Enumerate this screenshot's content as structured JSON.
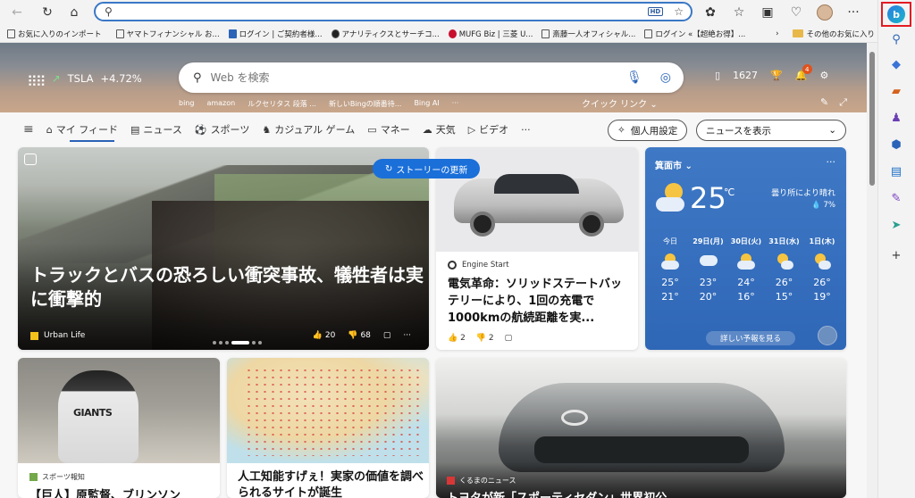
{
  "browser": {
    "address_value": "",
    "address_badge": "HD",
    "favorites": [
      {
        "label": "お気に入りのインポート",
        "icon": "import-icon"
      },
      {
        "label": "ヤマトフィナンシャル お...",
        "icon": "page-icon"
      },
      {
        "label": "ログイン | ご契約者様...",
        "icon": "blue-page-icon"
      },
      {
        "label": "アナリティクスとサーチコ...",
        "icon": "dark-circle-icon"
      },
      {
        "label": "MUFG Biz | 三菱 U...",
        "icon": "mufg-icon"
      },
      {
        "label": "斎藤一人オフィシャル...",
        "icon": "page-icon"
      },
      {
        "label": "ログイン «【超絶お得】...",
        "icon": "page-icon"
      }
    ],
    "other_favorites": "その他のお気に入り"
  },
  "hero": {
    "stock_symbol": "TSLA",
    "stock_change": "+4.72%",
    "search_placeholder": "Web を検索",
    "quick_links": [
      "bing",
      "amazon",
      "ルクセリタス 段落 ...",
      "新しいBingの順番待...",
      "Bing AI",
      "···"
    ],
    "quick_link_menu": "クイック リンク ⌄",
    "rewards_points": "1627",
    "notification_count": "4"
  },
  "tabs": {
    "items": [
      {
        "label": "マイ フィード",
        "icon": "home-icon"
      },
      {
        "label": "ニュース",
        "icon": "newspaper-icon"
      },
      {
        "label": "スポーツ",
        "icon": "sports-icon"
      },
      {
        "label": "カジュアル ゲーム",
        "icon": "game-icon"
      },
      {
        "label": "マネー",
        "icon": "money-icon"
      },
      {
        "label": "天気",
        "icon": "weather-icon"
      },
      {
        "label": "ビデオ",
        "icon": "video-icon"
      },
      {
        "label": "···",
        "icon": "more-icon"
      }
    ],
    "personalize": "個人用設定",
    "show_select": "ニュースを表示"
  },
  "big_story": {
    "refresh_label": "ストーリーの更新",
    "title": "トラックとバスの恐ろしい衝突事故、犠牲者は実に衝撃的",
    "source": "Urban Life",
    "likes": "20",
    "dislikes": "68"
  },
  "ev_story": {
    "source": "Engine Start",
    "title": "電気革命：ソリッドステートバッテリーにより、1回の充電で1000kmの航続距離を実...",
    "likes": "2",
    "dislikes": "2"
  },
  "weather": {
    "location": "箕面市",
    "temperature": "25",
    "unit": "℃",
    "condition": "曇り所により晴れ",
    "rain_chance": "7%",
    "forecast": [
      {
        "day": "今日",
        "hi": "25°",
        "lo": "21°",
        "icon": "partly-cloudy-icon"
      },
      {
        "day": "29日(月)",
        "hi": "23°",
        "lo": "20°",
        "icon": "rain-cloud-icon"
      },
      {
        "day": "30日(火)",
        "hi": "24°",
        "lo": "16°",
        "icon": "partly-cloudy-icon"
      },
      {
        "day": "31日(水)",
        "hi": "26°",
        "lo": "15°",
        "icon": "partly-sunny-icon"
      },
      {
        "day": "1日(木)",
        "hi": "26°",
        "lo": "19°",
        "icon": "partly-sunny-icon"
      }
    ],
    "detail_button": "詳しい予報を見る"
  },
  "giants_story": {
    "source": "スポーツ報知",
    "title": "【巨人】原監督、ブリンソン",
    "jersey_text": "GIANTS"
  },
  "map_story": {
    "title": "人工知能すげぇ！実家の価値を調べられるサイトが誕生"
  },
  "toyota_story": {
    "source": "くるまのニュース",
    "title": "トヨタが新「スポーティセダン」世界初公"
  }
}
